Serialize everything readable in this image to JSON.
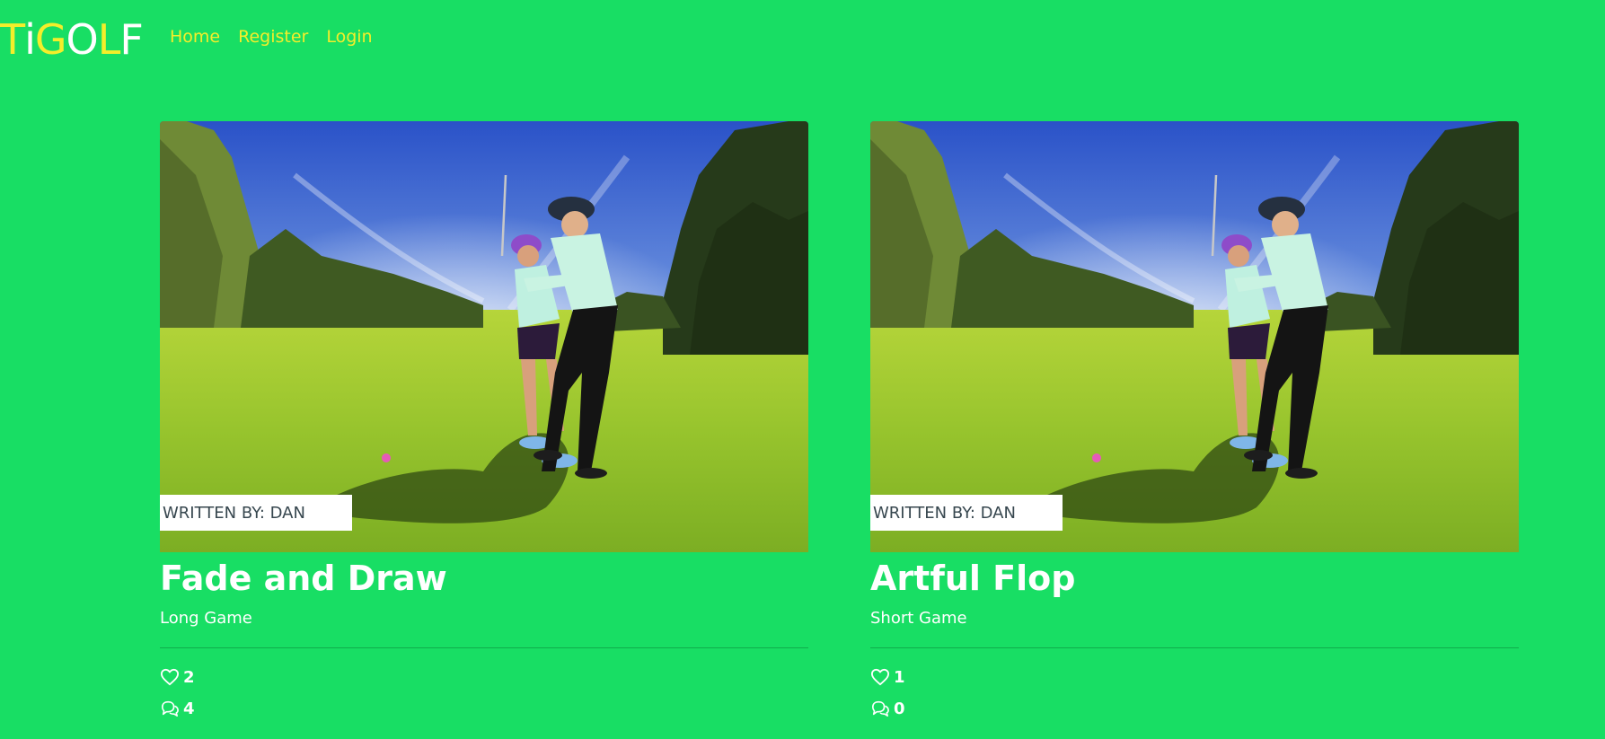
{
  "brand": {
    "letters": [
      {
        "char": "T",
        "color": "#f4ee2a"
      },
      {
        "char": "i",
        "color": "#ffffff"
      },
      {
        "char": "G",
        "color": "#f4ee2a"
      },
      {
        "char": "O",
        "color": "#ffffff"
      },
      {
        "char": "L",
        "color": "#f4ee2a"
      },
      {
        "char": "F",
        "color": "#ffffff"
      }
    ]
  },
  "nav": {
    "items": [
      {
        "label": "Home"
      },
      {
        "label": "Register"
      },
      {
        "label": "Login"
      }
    ]
  },
  "colors": {
    "background": "#18de64",
    "nav_link": "#f4ee2a",
    "card_text": "#ffffff",
    "author_tag_bg": "#ffffff",
    "author_tag_text": "#37474f"
  },
  "posts": [
    {
      "author": "WRITTEN BY: DAN",
      "title": "Fade and Draw",
      "category": "Long Game",
      "likes": "2",
      "comments": "4",
      "image": "golf-lesson-photo"
    },
    {
      "author": "WRITTEN BY: DAN",
      "title": "Artful Flop",
      "category": "Short Game",
      "likes": "1",
      "comments": "0",
      "image": "golf-lesson-photo"
    }
  ],
  "icons": {
    "like": "heart-icon",
    "comment": "comments-icon"
  }
}
